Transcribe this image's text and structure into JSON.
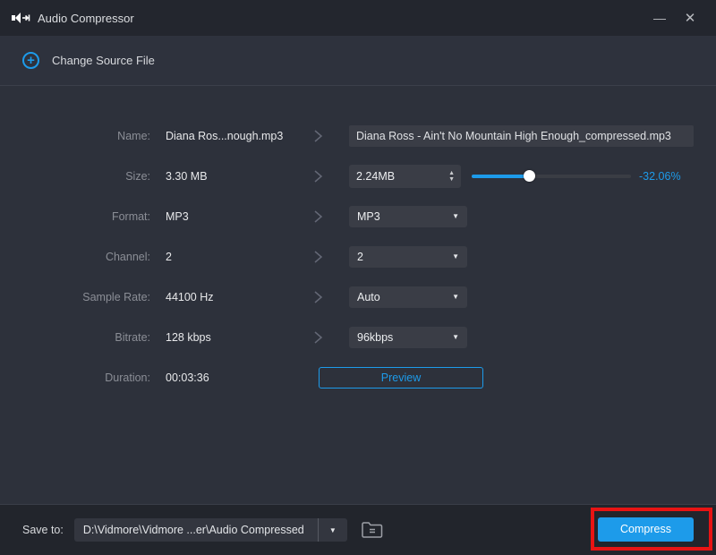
{
  "titlebar": {
    "title": "Audio Compressor"
  },
  "icons": {
    "minimize": "—",
    "close": "✕",
    "dropdown_arrow": "▼",
    "spinner_up": "▲",
    "spinner_down": "▼",
    "plus": "+"
  },
  "source": {
    "change_label": "Change Source File"
  },
  "fields": {
    "name": {
      "label": "Name:",
      "original": "Diana Ros...nough.mp3",
      "output": "Diana Ross - Ain't No Mountain High Enough_compressed.mp3"
    },
    "size": {
      "label": "Size:",
      "original": "3.30 MB",
      "target": "2.24MB",
      "reduction": "-32.06%"
    },
    "format": {
      "label": "Format:",
      "original": "MP3",
      "selected": "MP3"
    },
    "channel": {
      "label": "Channel:",
      "original": "2",
      "selected": "2"
    },
    "sample_rate": {
      "label": "Sample Rate:",
      "original": "44100 Hz",
      "selected": "Auto"
    },
    "bitrate": {
      "label": "Bitrate:",
      "original": "128 kbps",
      "selected": "96kbps"
    },
    "duration": {
      "label": "Duration:",
      "original": "00:03:36"
    }
  },
  "buttons": {
    "preview": "Preview",
    "compress": "Compress"
  },
  "footer": {
    "save_to_label": "Save to:",
    "save_path": "D:\\Vidmore\\Vidmore ...er\\Audio Compressed"
  },
  "colors": {
    "accent": "#1d9bea",
    "highlight_red": "#e81414"
  }
}
